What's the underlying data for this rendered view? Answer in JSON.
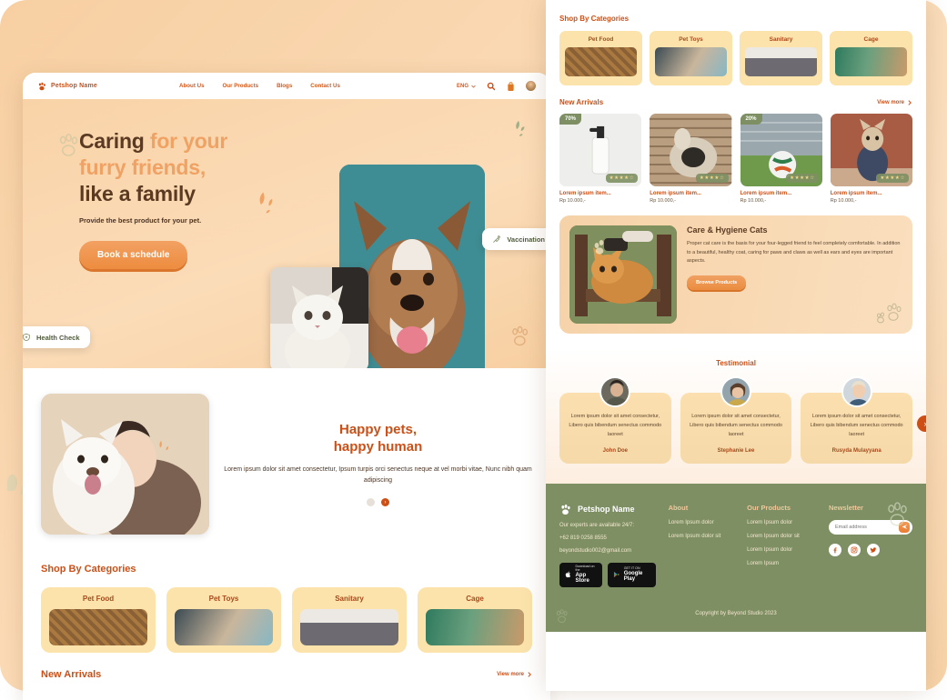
{
  "theme": {
    "brand_orange": "#cd4f16",
    "peach": "#f7cfa2",
    "cream": "#fbe3ab",
    "green": "#7d8f63",
    "teal": "#3f8d94"
  },
  "left_mock": {
    "navbar": {
      "brand": "Petshop Name",
      "logo_icon": "paw-icon",
      "links": [
        "About Us",
        "Our Products",
        "Blogs",
        "Contact Us"
      ],
      "language": "ENG",
      "chevron_icon": "chevron-down-icon",
      "search_icon": "search-icon",
      "cart_icon": "shopping-bag-icon",
      "avatar_icon": "user-avatar"
    },
    "hero": {
      "title_line1_dark": "Caring",
      "title_line1_light": "for your",
      "title_line2_light": "furry friends,",
      "title_line3_dark": "like a family",
      "subtitle": "Provide the best product for your pet.",
      "cta_label": "Book a schedule",
      "pill_vaccination": "Vaccination",
      "pill_vaccination_icon": "syringe-icon",
      "pill_health": "Health Check",
      "pill_health_icon": "shield-heart-icon",
      "dog_image_alt": "dog-portrait",
      "cat_image_alt": "white-cat"
    },
    "happy": {
      "title_line1": "Happy pets,",
      "title_line2": "happy human",
      "body": "Lorem ipsum dolor sit amet consectetur, Ipsum turpis orci senectus neque at vel morbi vitae, Nunc nibh quam adipiscing",
      "image_alt": "woman-with-white-dog",
      "next_arrow": "›"
    },
    "categories": {
      "title": "Shop By Categories",
      "items": [
        {
          "label": "Pet Food",
          "image_alt": "dog-food-bowl"
        },
        {
          "label": "Pet Toys",
          "image_alt": "toy-robot-and-ball"
        },
        {
          "label": "Sanitary",
          "image_alt": "grooming-bottles"
        },
        {
          "label": "Cage",
          "image_alt": "green-pet-cage"
        }
      ]
    },
    "new_arrivals": {
      "title": "New Arrivals",
      "view_more": "View more"
    }
  },
  "right_mock": {
    "categories": {
      "title": "Shop By Categories",
      "items": [
        {
          "label": "Pet Food",
          "image_alt": "dog-food-bowl"
        },
        {
          "label": "Pet Toys",
          "image_alt": "toy-robot-and-ball"
        },
        {
          "label": "Sanitary",
          "image_alt": "grooming-bottles"
        },
        {
          "label": "Cage",
          "image_alt": "green-pet-cage"
        }
      ]
    },
    "new_arrivals": {
      "title": "New Arrivals",
      "view_more": "View more",
      "chevron_icon": "chevron-right-icon",
      "products": [
        {
          "discount": "70%",
          "stars": "★★★★☆",
          "name": "Lorem ipsum item...",
          "price": "Rp 10.000,-",
          "image_alt": "white-pump-bottle"
        },
        {
          "discount": "",
          "stars": "★★★★☆",
          "name": "Lorem ipsum item...",
          "price": "Rp 10.000,-",
          "image_alt": "cat-in-woven-bed"
        },
        {
          "discount": "20%",
          "stars": "★★★★☆",
          "name": "Lorem ipsum item...",
          "price": "Rp 10.000,-",
          "image_alt": "soccer-ball-on-grass"
        },
        {
          "discount": "",
          "stars": "★★★★☆",
          "name": "Lorem ipsum item...",
          "price": "Rp 10.000,-",
          "image_alt": "dog-in-shirt"
        }
      ]
    },
    "care": {
      "title": "Care & Hygiene Cats",
      "body": "Proper cat care is the basis for your four-legged friend to feel completely comfortable. In addition to a beautiful, healthy coat, caring for paws and claws as well as ears and eyes are important aspects.",
      "button": "Browse Products",
      "image_alt": "orange-cat-being-brushed"
    },
    "testimonial": {
      "title": "Testimonial",
      "next_arrow": "›",
      "items": [
        {
          "text": "Lorem ipsum dolor sit amet consectetur, Libero quis bibendum senectus commodo laoreet",
          "name": "John Doe",
          "avatar_alt": "avatar-john-doe"
        },
        {
          "text": "Lorem ipsum dolor sit amet consectetur, Libero quis bibendum senectus commodo laoreet",
          "name": "Stephanie Lee",
          "avatar_alt": "avatar-stephanie-lee"
        },
        {
          "text": "Lorem ipsum dolor sit amet consectetur, Libero quis bibendum senectus commodo laoreet",
          "name": "Rusyda Mulayyana",
          "avatar_alt": "avatar-rusyda-mulayyana"
        }
      ]
    },
    "footer": {
      "brand": "Petshop Name",
      "logo_icon": "paw-icon",
      "tagline": "Our experts are available 24/7:",
      "phone": "+62 819 0258 8555",
      "email": "beyondstudio002@gmail.com",
      "appstore": {
        "small": "Download on the",
        "big": "App Store",
        "icon": "apple-icon"
      },
      "googleplay": {
        "small": "GET IT ON",
        "big": "Google Play",
        "icon": "play-triangle-icon"
      },
      "about": {
        "title": "About",
        "links": [
          "Lorem Ipsum dolor",
          "Lorem Ipsum dolor sit"
        ]
      },
      "products": {
        "title": "Our Products",
        "links": [
          "Lorem Ipsum dolor",
          "Lorem Ipsum dolor sit",
          "Lorem Ipsum dolor",
          "Lorem Ipsum"
        ]
      },
      "newsletter": {
        "title": "Newsletter",
        "placeholder": "Email address",
        "value": "",
        "send_icon": "send-icon",
        "socials": [
          "facebook-icon",
          "instagram-icon",
          "twitter-icon"
        ]
      },
      "copyright": "Copyright by Beyond Studio 2023"
    }
  }
}
